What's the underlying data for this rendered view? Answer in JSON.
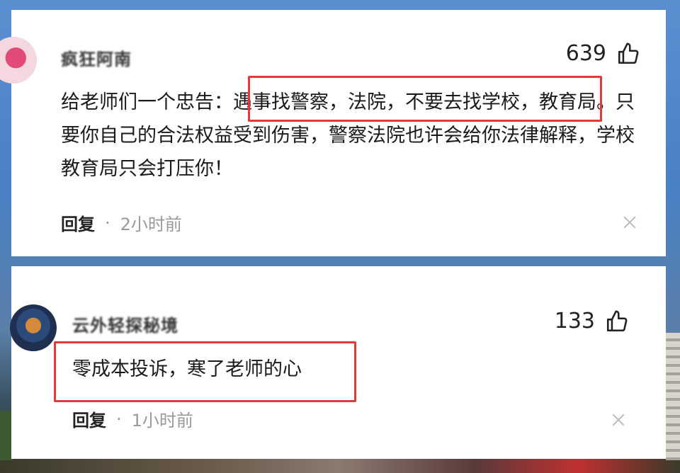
{
  "comments": [
    {
      "username": "疯狂阿南",
      "likes": "639",
      "content": "给老师们一个忠告：遇事找警察，法院，不要去找学校，教育局。只要你自己的合法权益受到伤害，警察法院也许会给你法律解释，学校教育局只会打压你！",
      "highlighted": "遇事找警察，法院，不要去找学校，",
      "reply_label": "回复",
      "time": "2小时前"
    },
    {
      "username": "云外轻探秘境",
      "likes": "133",
      "content": "零成本投诉，寒了老师的心",
      "highlighted": "零成本投诉，寒了老师的心",
      "reply_label": "回复",
      "time": "1小时前"
    }
  ],
  "colors": {
    "highlight_border": "#e53935",
    "meta_gray": "#999999"
  },
  "icons": [
    "thumbs-up-icon",
    "close-icon",
    "avatar"
  ]
}
